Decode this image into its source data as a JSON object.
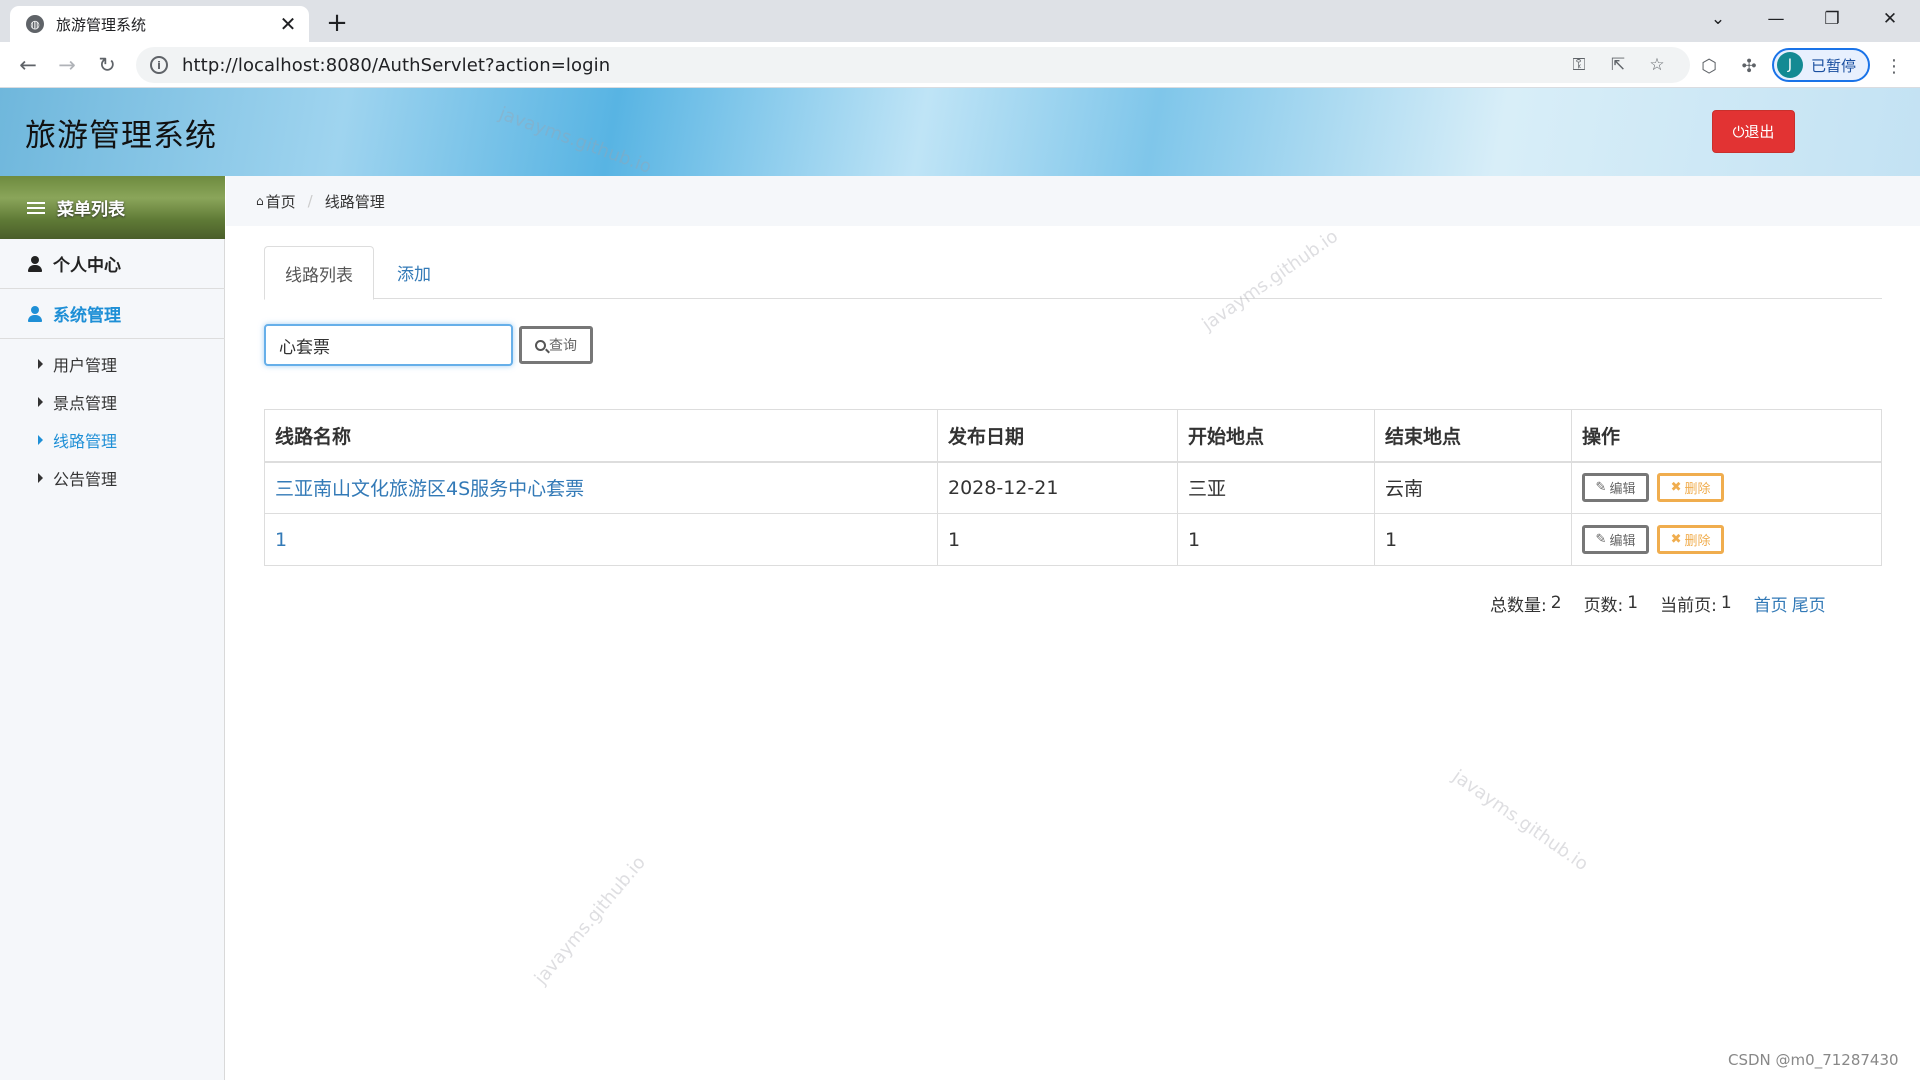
{
  "browser": {
    "tab_title": "旅游管理系统",
    "url": "http://localhost:8080/AuthServlet?action=login",
    "profile_initial": "J",
    "profile_label": "已暂停"
  },
  "app": {
    "title": "旅游管理系统",
    "logout_label": "⏻退出"
  },
  "sidebar": {
    "menu_title": "菜单列表",
    "sections": [
      {
        "label": "个人中心",
        "active": false
      },
      {
        "label": "系统管理",
        "active": true
      }
    ],
    "items": [
      {
        "label": "用户管理",
        "active": false
      },
      {
        "label": "景点管理",
        "active": false
      },
      {
        "label": "线路管理",
        "active": true
      },
      {
        "label": "公告管理",
        "active": false
      }
    ]
  },
  "breadcrumb": {
    "home": "首页",
    "current": "线路管理"
  },
  "tabs": [
    "线路列表",
    "添加"
  ],
  "search": {
    "value": "心套票",
    "button_label": "查询"
  },
  "table": {
    "headers": [
      "线路名称",
      "发布日期",
      "开始地点",
      "结束地点",
      "操作"
    ],
    "rows": [
      [
        "三亚南山文化旅游区4S服务中心套票",
        "2028-12-21",
        "三亚",
        "云南"
      ],
      [
        "1",
        "1",
        "1",
        "1"
      ]
    ],
    "edit_label": "编辑",
    "delete_label": "删除"
  },
  "pager": {
    "total_label": "总数量:",
    "total": "2",
    "pages_label": "页数:",
    "pages": "1",
    "current_label": "当前页:",
    "current": "1",
    "first": "首页",
    "last": "尾页"
  },
  "watermark": "javayms.github.io",
  "credit": "CSDN @m0_71287430",
  "colors": {
    "link": "#337ab7",
    "logout": "#e23333",
    "delete": "#f0ad4e",
    "active_menu": "#1e8fd6"
  }
}
